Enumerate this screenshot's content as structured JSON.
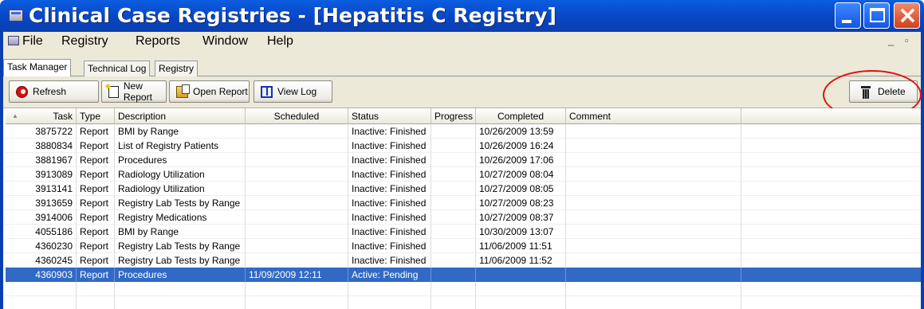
{
  "window": {
    "title": "Clinical Case Registries - [Hepatitis C Registry]"
  },
  "menu": {
    "items": [
      "File",
      "Registry",
      "Reports",
      "Window",
      "Help"
    ],
    "mdi_controls": "_ ▫ ×"
  },
  "tabs": [
    {
      "label": "Task Manager",
      "active": true
    },
    {
      "label": "Technical Log",
      "active": false
    },
    {
      "label": "Registry",
      "active": false
    }
  ],
  "toolbar": {
    "refresh_label": "Refresh",
    "new_report_label": "New Report",
    "open_report_label": "Open Report",
    "view_log_label": "View Log",
    "delete_label": "Delete"
  },
  "icons": {
    "refresh": "refresh-icon",
    "new_report": "new-document-icon",
    "open_report": "open-report-icon",
    "view_log": "book-icon",
    "delete": "trash-icon"
  },
  "colors": {
    "titlebar": "#0845c2",
    "selected_row": "#316ac5",
    "annotation": "#e01010"
  },
  "grid": {
    "columns": [
      "Task",
      "Type",
      "Description",
      "Scheduled",
      "Status",
      "Progress",
      "Completed",
      "Comment"
    ],
    "rows": [
      {
        "task": "3875722",
        "type": "Report",
        "description": "BMI by Range",
        "scheduled": "",
        "status": "Inactive: Finished",
        "progress": "",
        "completed": "10/26/2009 13:59",
        "comment": ""
      },
      {
        "task": "3880834",
        "type": "Report",
        "description": "List of Registry Patients",
        "scheduled": "",
        "status": "Inactive: Finished",
        "progress": "",
        "completed": "10/26/2009 16:24",
        "comment": ""
      },
      {
        "task": "3881967",
        "type": "Report",
        "description": "Procedures",
        "scheduled": "",
        "status": "Inactive: Finished",
        "progress": "",
        "completed": "10/26/2009 17:06",
        "comment": ""
      },
      {
        "task": "3913089",
        "type": "Report",
        "description": "Radiology Utilization",
        "scheduled": "",
        "status": "Inactive: Finished",
        "progress": "",
        "completed": "10/27/2009 08:04",
        "comment": ""
      },
      {
        "task": "3913141",
        "type": "Report",
        "description": "Radiology Utilization",
        "scheduled": "",
        "status": "Inactive: Finished",
        "progress": "",
        "completed": "10/27/2009 08:05",
        "comment": ""
      },
      {
        "task": "3913659",
        "type": "Report",
        "description": "Registry Lab Tests by Range",
        "scheduled": "",
        "status": "Inactive: Finished",
        "progress": "",
        "completed": "10/27/2009 08:23",
        "comment": ""
      },
      {
        "task": "3914006",
        "type": "Report",
        "description": "Registry Medications",
        "scheduled": "",
        "status": "Inactive: Finished",
        "progress": "",
        "completed": "10/27/2009 08:37",
        "comment": ""
      },
      {
        "task": "4055186",
        "type": "Report",
        "description": "BMI by Range",
        "scheduled": "",
        "status": "Inactive: Finished",
        "progress": "",
        "completed": "10/30/2009 13:07",
        "comment": ""
      },
      {
        "task": "4360230",
        "type": "Report",
        "description": "Registry Lab Tests by Range",
        "scheduled": "",
        "status": "Inactive: Finished",
        "progress": "",
        "completed": "11/06/2009 11:51",
        "comment": ""
      },
      {
        "task": "4360245",
        "type": "Report",
        "description": "Registry Lab Tests by Range",
        "scheduled": "",
        "status": "Inactive: Finished",
        "progress": "",
        "completed": "11/06/2009 11:52",
        "comment": ""
      },
      {
        "task": "4360903",
        "type": "Report",
        "description": "Procedures",
        "scheduled": "11/09/2009 12:11",
        "status": "Active: Pending",
        "progress": "",
        "completed": "",
        "comment": "",
        "selected": true
      }
    ]
  }
}
